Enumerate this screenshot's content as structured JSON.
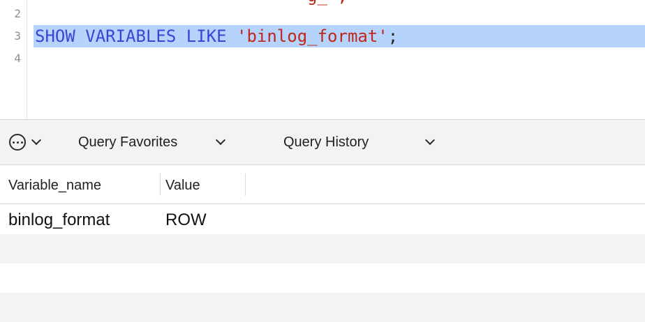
{
  "editor": {
    "partial_top_text": "g_      ;",
    "line_numbers": [
      "2",
      "3",
      "4"
    ],
    "query": {
      "kw1": "SHOW",
      "kw2": "VARIABLES",
      "kw3": "LIKE",
      "string": "'binlog_format'",
      "terminator": ";"
    }
  },
  "toolbar": {
    "more_icon": "ellipsis-circle-icon",
    "favorites_label": "Query Favorites",
    "history_label": "Query History"
  },
  "results": {
    "columns": [
      "Variable_name",
      "Value"
    ],
    "rows": [
      [
        "binlog_format",
        "ROW"
      ]
    ]
  },
  "colors": {
    "keyword": "#3c43d6",
    "string": "#c0271b",
    "selection": "#b6d4fb"
  }
}
